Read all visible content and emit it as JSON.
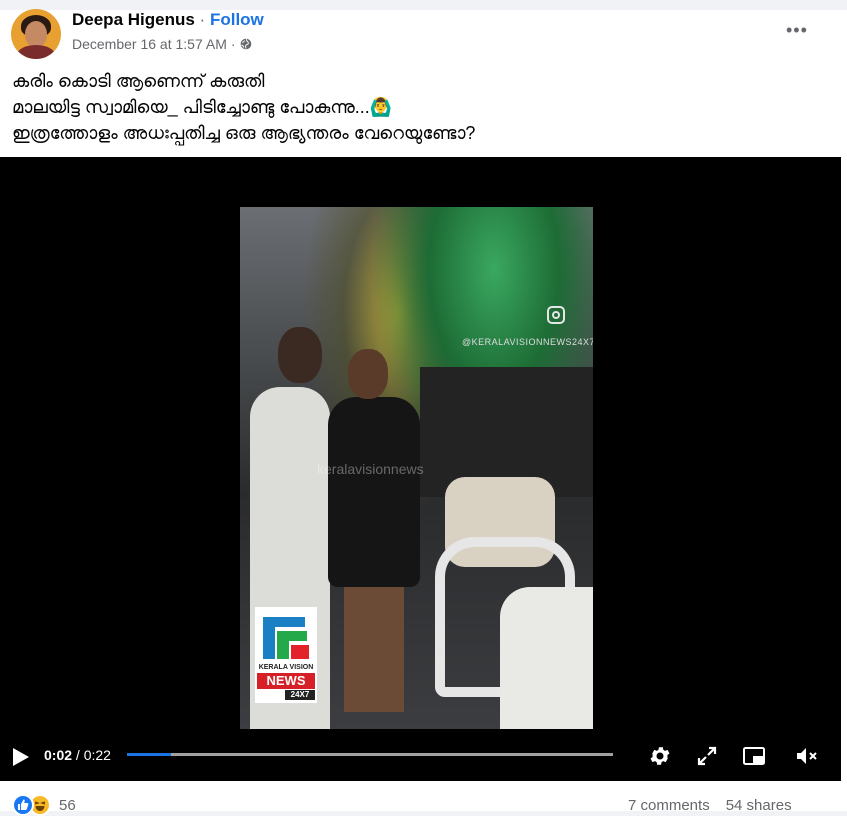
{
  "post": {
    "author": "Deepa Higenus",
    "separator": "·",
    "follow_label": "Follow",
    "timestamp": "December 16 at 1:57 AM",
    "meta_separator": "·",
    "privacy_icon": "globe-icon",
    "more_label": "•••"
  },
  "caption": {
    "lines": [
      "കരിം കൊടി ആണെന്ന് കരുതി",
      "മാലയിട്ട സ്വാമിയെ_ പിടിച്ചോണ്ടു പോകുന്നു...🙆‍♂️",
      "ഇത്രത്തോളം അധഃപ്പതിച്ച ഒരു ആഭ്യന്തരം വേറെയുണ്ടോ?"
    ]
  },
  "video": {
    "watermark": "@KERALAVISIONNEWS24X7",
    "center_watermark": "keralavisionnews",
    "logo": {
      "brand": "KERALA VISION",
      "word": "NEWS",
      "badge": "24X7"
    },
    "current_time": "0:02",
    "time_separator": " / ",
    "duration": "0:22",
    "progress_fraction": 0.0909,
    "icons": [
      "play-icon",
      "settings-icon",
      "fullscreen-icon",
      "miniplayer-icon",
      "muted-icon"
    ]
  },
  "engagement": {
    "reaction_icons": [
      "like-icon",
      "haha-icon"
    ],
    "reaction_count": "56",
    "comments": "7 comments",
    "shares": "54 shares"
  },
  "colors": {
    "accent": "#1b74e4",
    "secondary_text": "#65676b",
    "progress": "#1b74e4",
    "like": "#1877f2"
  }
}
